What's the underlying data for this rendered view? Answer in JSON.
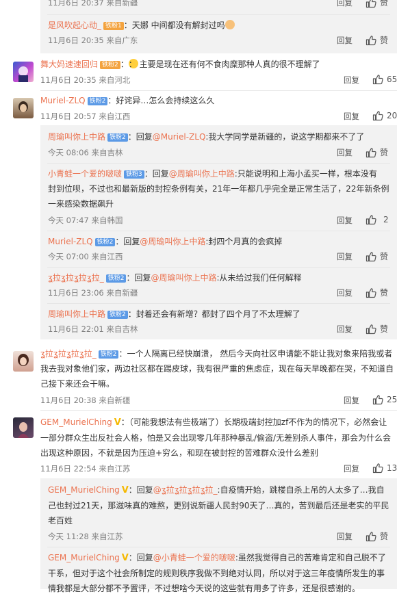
{
  "ui": {
    "reply_label": "回复",
    "like_label": "赞"
  },
  "top_sub": {
    "c0": {
      "time": "11月6日 20:37 来自新疆"
    },
    "c1": {
      "user": "是风吹起心动_",
      "badge": "铁粉1",
      "text": "：天娜 中间都没有解封过吗",
      "time": "11月6日 20:35 来自广东"
    }
  },
  "comments": [
    {
      "user": "舞大妈速速回归",
      "badge": "铁粉2",
      "text": "：  主要是现在还有何不食肉糜那种人真的很不理解了",
      "time": "11月6日 20:35 来自河北",
      "likes": "65"
    },
    {
      "user": "Muriel-ZLQ",
      "badge": "铁粉2",
      "text": "：好诧异…怎么会持续这么久",
      "time": "11月6日 20:57 来自江西",
      "likes": "20",
      "replies": [
        {
          "user": "周瑜叫你上中路",
          "badge": "铁粉2",
          "pre": "：回复",
          "mention": "@Muriel-ZLQ",
          "text": ":我大学同学是新疆的，说这学期都来不了了",
          "time": "今天 08:06 来自吉林",
          "likes": ""
        },
        {
          "user": "小青蛙一个爱的啵啵",
          "badge": "铁粉3",
          "pre": "：回复",
          "mention": "@周瑜叫你上中路",
          "text": ":只能说明和上海小孟买一样，根本没有",
          "line2": "封到位呗，不过也和最新版的封控条例有关，21年一年都几乎完全是正常生活了，22年新条例",
          "line3": "一来感染数据飙升",
          "time": "今天 07:47 来自韩国",
          "likes": "2"
        },
        {
          "user": "Muriel-ZLQ",
          "badge": "铁粉2",
          "pre": "：回复",
          "mention": "@周瑜叫你上中路",
          "text": ":封四个月真的会疯掉",
          "time": "今天 07:00 来自江西",
          "likes": ""
        },
        {
          "user": "ʓ拉ʓ拉ʓ拉ʓ拉_",
          "badge": "铁粉2",
          "pre": "：回复",
          "mention": "@周瑜叫你上中路",
          "text": ":从未给过我们任何解释",
          "time": "11月6日 23:06 来自新疆",
          "likes": ""
        },
        {
          "user": "周瑜叫你上中路",
          "badge": "铁粉2",
          "pre": "：",
          "mention": "",
          "text": "封着还会有新增？都封了四个月了不太理解了",
          "time": "11月6日 22:01 来自吉林",
          "likes": ""
        }
      ]
    },
    {
      "user": "ʓ拉ʓ拉ʓ拉ʓ拉_",
      "badge": "铁粉2",
      "text": "：一个人隔离已经快崩溃， 然后今天向社区申请能不能让我对象来陪我或者",
      "line2": "我去我对象他们家，两边社区都在踢皮球，我有很严重的焦虑症，现在每天早晚都在哭，不知道自",
      "line3": "己接下来还会干嘛。",
      "time": "11月6日 20:38 来自新疆",
      "likes": "25"
    },
    {
      "user": "GEM_MurielChing",
      "badge": "V",
      "text": "：（可能我想法有些极端了）长期极端封控加zf不作为的情况下，必然会让",
      "line2": "一部分群众生出反社会人格，怕是又会出现零几年那种暴乱/偷盗/无差别杀人事件，那会为什么会",
      "line3": "出现这种原因，不就是因为压迫+穷么，和现在被封控的苦难群众没什么差别",
      "time": "11月6日 22:54 来自江苏",
      "likes": "13",
      "replies": [
        {
          "user": "GEM_MurielChing",
          "badge": "V",
          "pre": "：回复",
          "mention": "@ʓ拉ʓ拉ʓ拉ʓ拉_",
          "text": ":自疫情开始，跳楼自杀上吊的人太多了…我自",
          "line2": "己也封过21天，那滋味真的难熬，更别说新疆人民封90天了…真的，苦到最后还是老实的平民",
          "line3": "老百姓",
          "time": "今天 11:28 来自江苏",
          "likes": ""
        },
        {
          "user": "GEM_MurielChing",
          "badge": "V",
          "pre": "：回复",
          "mention": "@小青蛙一个爱的啵啵",
          "text": ":虽然我觉得自己的苦难肯定和自己脱不了",
          "line2": "干系，但对于这个社会所制定的规则秩序我做不到绝对认同，所以对于这三年疫情所发生的事",
          "line3": "情我都是大部分都不予置评，不过想啥今天说的这些就有用多了许多，还是很感谢的。"
        }
      ]
    }
  ]
}
